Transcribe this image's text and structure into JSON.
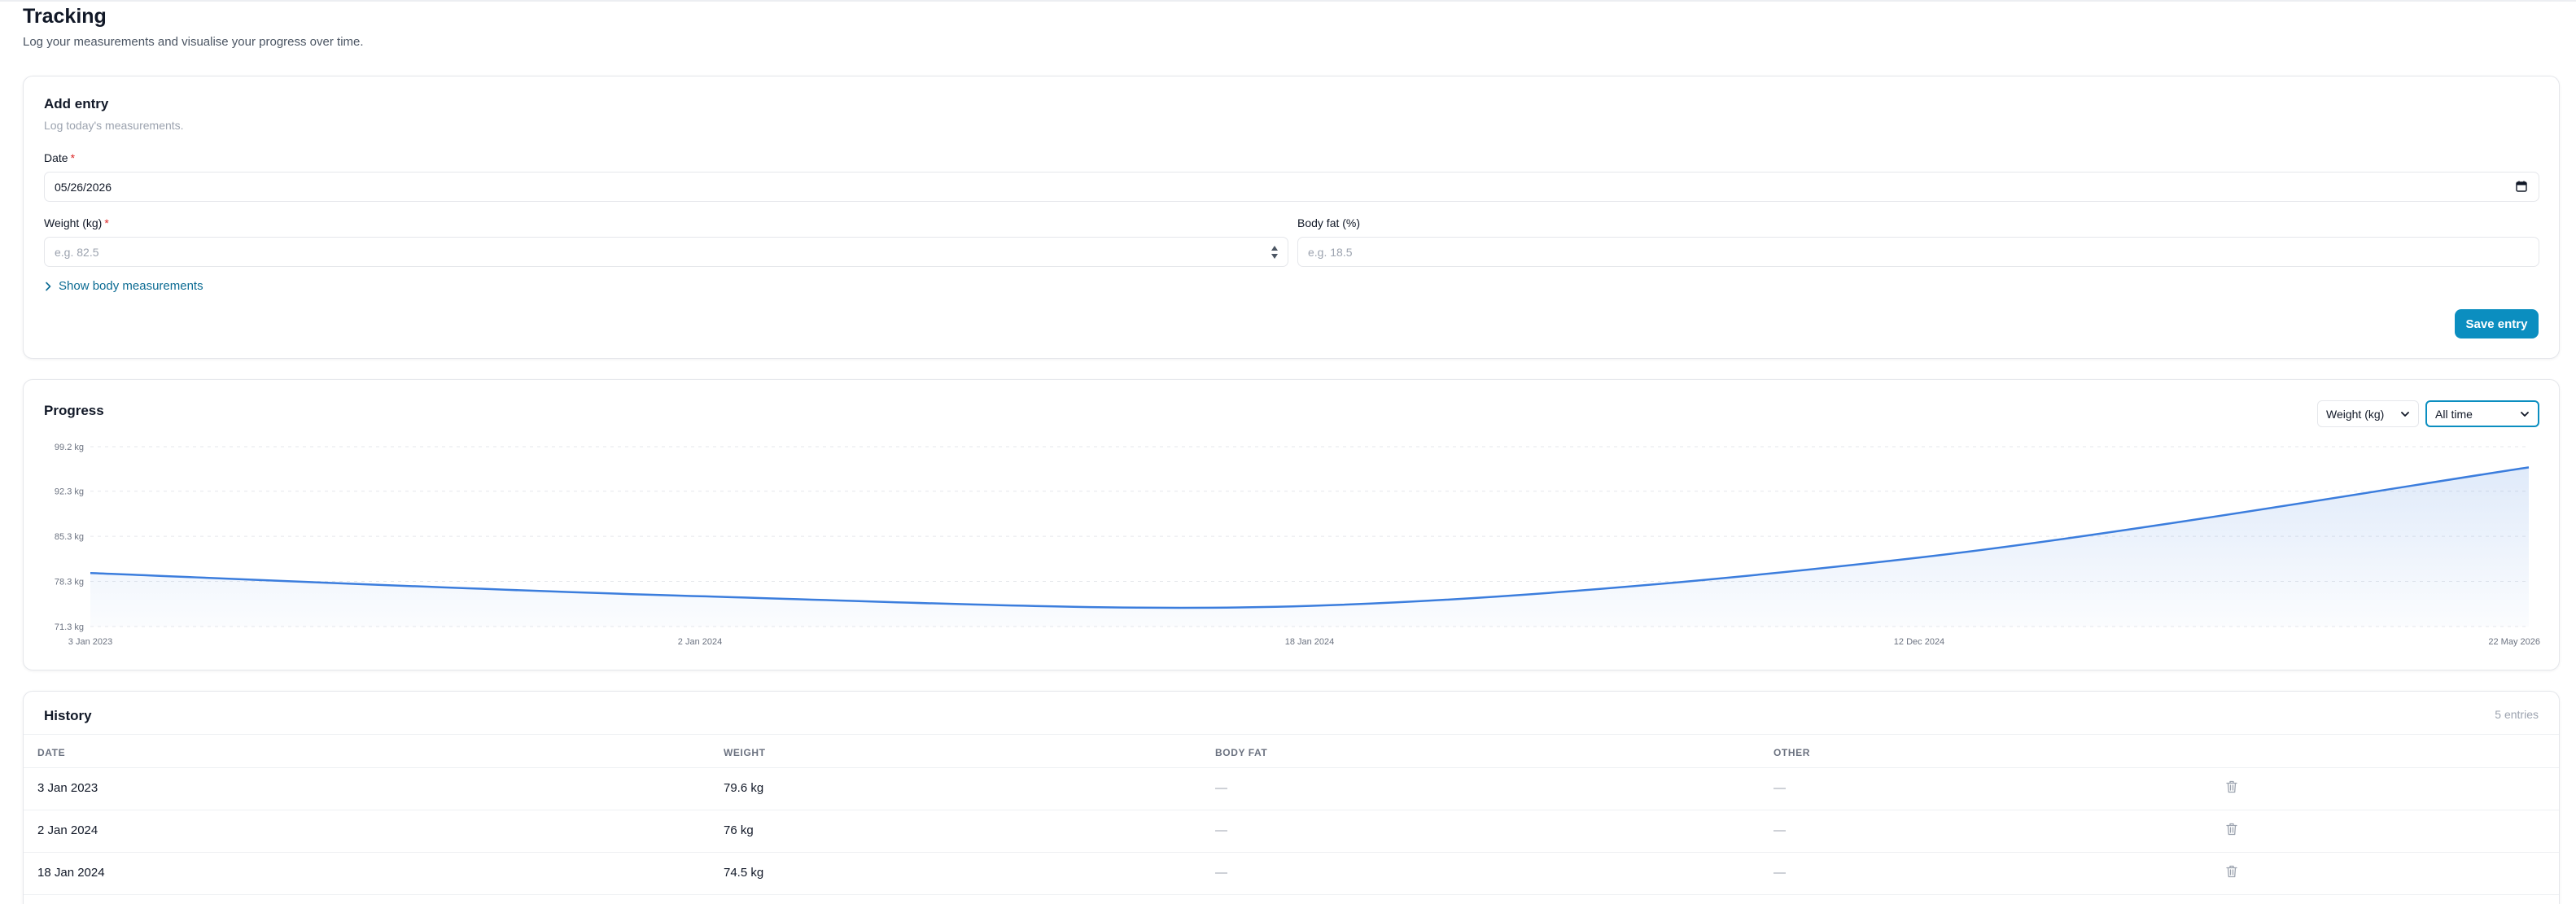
{
  "page": {
    "title": "Tracking",
    "subtitle": "Log your measurements and visualise your progress over time."
  },
  "add_entry": {
    "title": "Add entry",
    "subtitle": "Log today's measurements.",
    "date_label": "Date",
    "date_value": "05/26/2026",
    "weight_label": "Weight (kg)",
    "weight_placeholder": "e.g. 82.5",
    "bodyfat_label": "Body fat (%)",
    "bodyfat_placeholder": "e.g. 18.5",
    "required_mark": "*",
    "show_measurements": "Show body measurements",
    "save_label": "Save entry"
  },
  "progress": {
    "title": "Progress",
    "metric_select": "Weight (kg)",
    "range_select": "All time"
  },
  "chart_data": {
    "type": "area",
    "x": [
      "3 Jan 2023",
      "2 Jan 2024",
      "18 Jan 2024",
      "12 Dec 2024",
      "22 May 2026"
    ],
    "x_tick_labels": [
      "3 Jan 2023",
      "2 Jan 2024",
      "18 Jan 2024",
      "12 Dec 2024",
      "22 May 2026"
    ],
    "y_tick_labels": [
      "99.2 kg",
      "92.3 kg",
      "85.3 kg",
      "78.3 kg",
      "71.3 kg"
    ],
    "y_ticks": [
      99.2,
      92.3,
      85.3,
      78.3,
      71.3
    ],
    "series": [
      {
        "values": [
          79.6,
          76,
          74.5,
          82,
          96
        ]
      }
    ],
    "ylim": [
      71.3,
      99.2
    ],
    "grid": true,
    "color": "#3b7ddd"
  },
  "history": {
    "title": "History",
    "entries_count": "5 entries",
    "columns": [
      "DATE",
      "WEIGHT",
      "BODY FAT",
      "OTHER"
    ],
    "rows": [
      {
        "date": "3 Jan 2023",
        "weight": "79.6 kg",
        "body_fat": "—",
        "other": "—"
      },
      {
        "date": "2 Jan 2024",
        "weight": "76 kg",
        "body_fat": "—",
        "other": "—"
      },
      {
        "date": "18 Jan 2024",
        "weight": "74.5 kg",
        "body_fat": "—",
        "other": "—"
      }
    ]
  },
  "icons": {
    "calendar": "calendar-icon",
    "stepper": "stepper-icon",
    "chevron_right": "chevron-right-icon",
    "chevron_down": "chevron-down-icon",
    "trash": "trash-icon"
  },
  "colors": {
    "accent": "#0b8ec0",
    "link": "#0b6b93",
    "line": "#3b7ddd",
    "required": "#dc2626"
  }
}
